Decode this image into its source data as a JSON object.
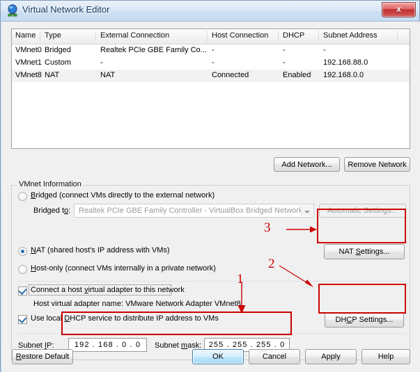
{
  "window": {
    "title": "Virtual Network Editor",
    "icon": "vmware-network-icon",
    "close_label": "x"
  },
  "network_list": {
    "columns": [
      "Name",
      "Type",
      "External Connection",
      "Host Connection",
      "DHCP",
      "Subnet Address"
    ],
    "rows": [
      {
        "name": "VMnet0",
        "type": "Bridged",
        "external_connection": "Realtek PCIe GBE Family Co...",
        "host_connection": "-",
        "dhcp": "-",
        "subnet_address": "-",
        "selected": false
      },
      {
        "name": "VMnet1",
        "type": "Custom",
        "external_connection": "-",
        "host_connection": "-",
        "dhcp": "-",
        "subnet_address": "192.168.88.0",
        "selected": false
      },
      {
        "name": "VMnet8",
        "type": "NAT",
        "external_connection": "NAT",
        "host_connection": "Connected",
        "dhcp": "Enabled",
        "subnet_address": "192.168.0.0",
        "selected": true
      }
    ]
  },
  "list_actions": {
    "add_network": "Add Network...",
    "remove_network": "Remove Network"
  },
  "vmnet_info": {
    "group_title": "VMnet Information",
    "bridged_label": "Bridged (connect VMs directly to the external network)",
    "bridged_to_label": "Bridged to:",
    "bridged_to_value": "Realtek PCIe GBE Family Controller - VirtualBox Bridged Networking",
    "automatic_settings": "Automatic Settings...",
    "nat_label": "NAT (shared host's IP address with VMs)",
    "nat_settings": "NAT Settings...",
    "host_only_label": "Host-only (connect VMs internally in a private network)",
    "connect_adapter_label": "Connect a host virtual adapter to this network",
    "adapter_name_label": "Host virtual adapter name: VMware Network Adapter VMnet8",
    "use_dhcp_label": "Use local DHCP service to distribute IP address to VMs",
    "dhcp_settings": "DHCP Settings...",
    "subnet_ip_label": "Subnet IP:",
    "subnet_ip_value": "192 . 168 .  0   .  0",
    "subnet_mask_label": "Subnet mask:",
    "subnet_mask_value": "255 . 255 . 255 .  0",
    "selected_option": "nat",
    "connect_adapter_checked": true,
    "use_dhcp_checked": true
  },
  "footer": {
    "restore_default": "Restore Default",
    "ok": "OK",
    "cancel": "Cancel",
    "apply": "Apply",
    "help": "Help"
  },
  "annotations": {
    "marker1": "1",
    "marker2": "2",
    "marker3": "3",
    "color": "#cc0000"
  }
}
